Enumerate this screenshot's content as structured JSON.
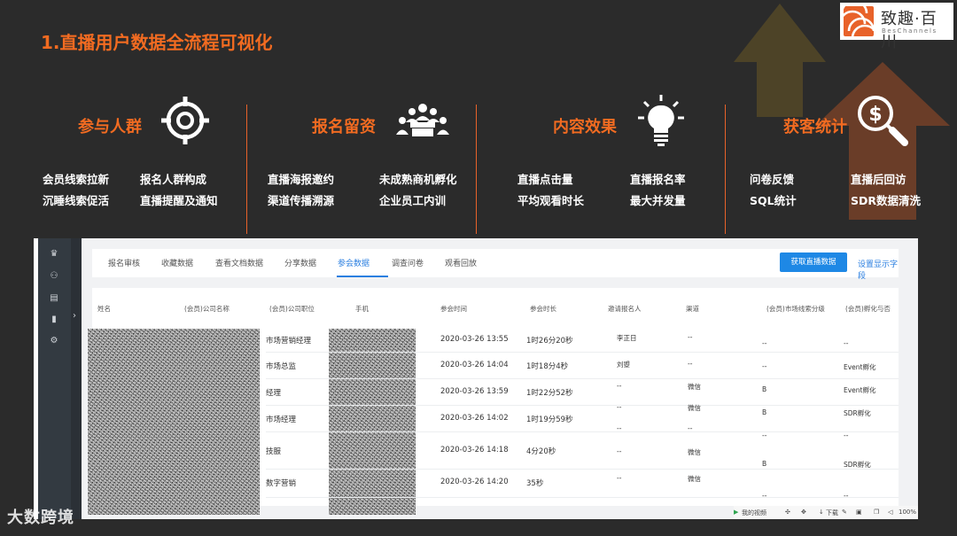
{
  "header": {
    "title": "1.直播用户数据全流程可视化"
  },
  "logo": {
    "name": "致趣·百川",
    "sub": "BesChannels"
  },
  "categories": [
    {
      "title": "参与人群",
      "icon": "target-icon",
      "features": [
        "会员线索拉新",
        "报名人群构成",
        "沉睡线索促活",
        "直播提醒及通知"
      ]
    },
    {
      "title": "报名留资",
      "icon": "meeting-people-icon",
      "features": [
        "直播海报邀约",
        "未成熟商机孵化",
        "渠道传播溯源",
        "企业员工内训"
      ]
    },
    {
      "title": "内容效果",
      "icon": "lightbulb-icon",
      "features": [
        "直播点击量",
        "直播报名率",
        "平均观看时长",
        "最大并发量"
      ]
    },
    {
      "title": "获客统计",
      "icon": "dollar-magnifier-icon",
      "features": [
        "问卷反馈",
        "直播后回访",
        "SQL统计",
        "SDR数据清洗"
      ]
    }
  ],
  "colors": {
    "accent": "#f26b21",
    "background": "#2b2b2b",
    "primary_button": "#1e88e5"
  },
  "app": {
    "tabs": [
      "报名审核",
      "收藏数据",
      "查看文档数据",
      "分享数据",
      "参会数据",
      "调查问卷",
      "观看回放"
    ],
    "active_tab": "参会数据",
    "fetch_button": "获取直播数据",
    "settings_link": "设置显示字段",
    "columns": [
      "姓名",
      "(会员)公司名称",
      "(会员)公司职位",
      "手机",
      "参会时间",
      "参会时长",
      "邀请报名人",
      "渠道",
      "(会员)市场线索分级",
      "(会员)孵化与否"
    ],
    "rows": [
      {
        "position": "市场营销经理",
        "time": "2020-03-26 13:55",
        "duration": "1时26分20秒",
        "inviter": "李正日",
        "channel": "--",
        "grade": "--",
        "incubate": "--"
      },
      {
        "position": "市场总监",
        "time": "2020-03-26 14:04",
        "duration": "1时18分4秒",
        "inviter": "刘曌",
        "channel": "--",
        "grade": "--",
        "incubate": "Event孵化"
      },
      {
        "position": "经理",
        "time": "2020-03-26 13:59",
        "duration": "1时22分52秒",
        "inviter": "--",
        "channel": "微信",
        "grade": "B",
        "incubate": "Event孵化"
      },
      {
        "position": "市场经理",
        "time": "2020-03-26 14:02",
        "duration": "1时19分59秒",
        "inviter": "--",
        "channel": "微信",
        "grade": "B",
        "incubate": "SDR孵化"
      },
      {
        "position": "",
        "time": "",
        "duration": "",
        "inviter": "--",
        "channel": "--",
        "grade": "--",
        "incubate": "--"
      },
      {
        "position": "技服",
        "time": "2020-03-26 14:18",
        "duration": "4分20秒",
        "inviter": "--",
        "channel": "微信",
        "grade": "B",
        "incubate": "SDR孵化"
      },
      {
        "position": "数字营销",
        "time": "2020-03-26 14:20",
        "duration": "35秒",
        "inviter": "--",
        "channel": "微信",
        "grade": "--",
        "incubate": "--"
      }
    ],
    "status": {
      "my_video": "我的视频",
      "download": "下载",
      "zoom": "100%"
    }
  },
  "watermark": "大数跨境"
}
